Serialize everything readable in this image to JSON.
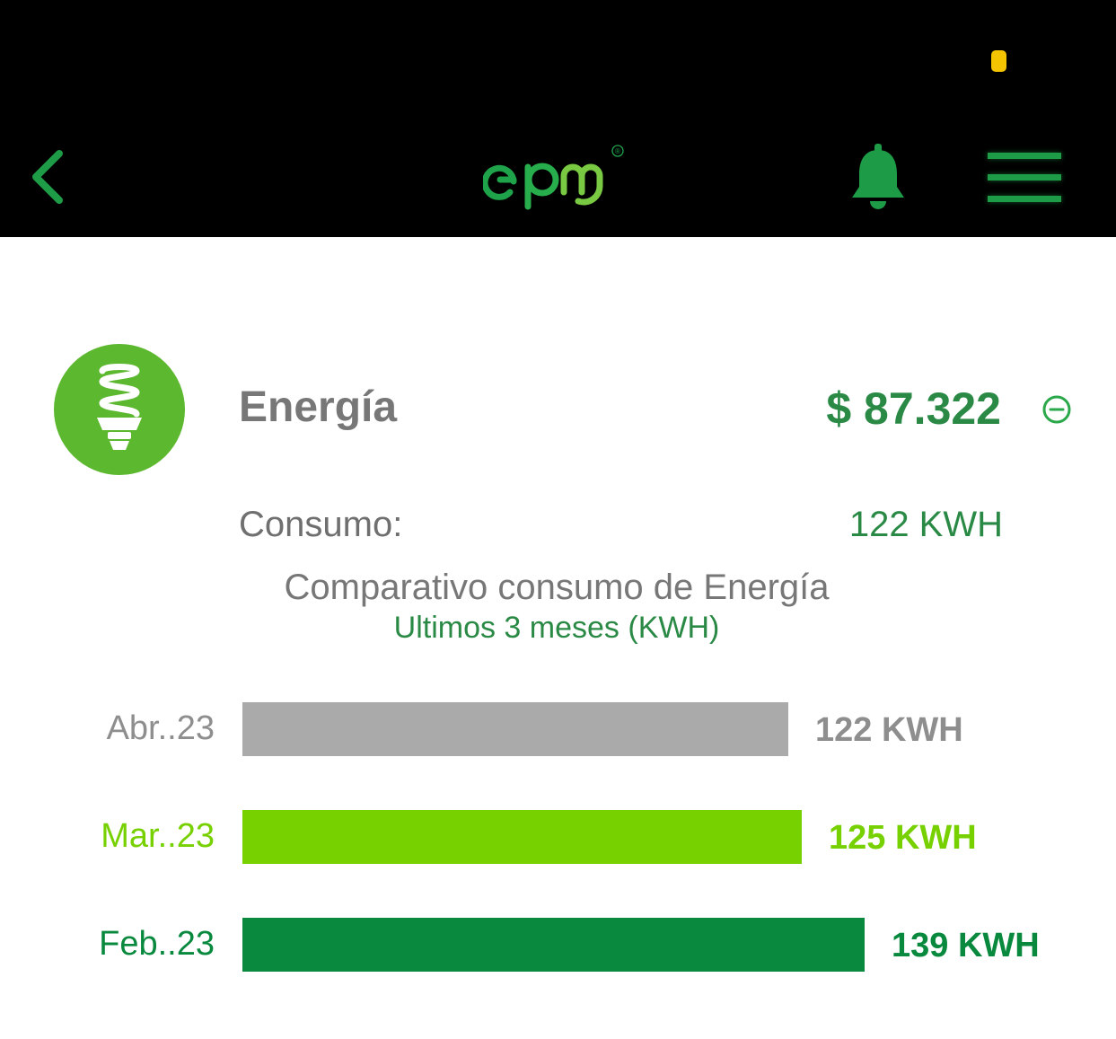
{
  "header": {
    "logo_text": "epm",
    "logo_mark": "®",
    "icons": [
      "chevron-left-icon",
      "bell-icon",
      "hamburger-menu-icon"
    ],
    "colors": {
      "bar_bg": "#000000",
      "accent": "#1e9b46",
      "status_dot": "#f5c400"
    }
  },
  "service": {
    "icon": "light-bulb-icon",
    "name": "Energía",
    "amount": "$ 87.322",
    "consumo_label": "Consumo:",
    "consumo_value": "122 KWH"
  },
  "comparison": {
    "title": "Comparativo consumo de Energía",
    "subtitle": "Ultimos 3 meses (KWH)"
  },
  "chart_data": {
    "type": "bar",
    "orientation": "horizontal",
    "categories": [
      "Abr..23",
      "Mar..23",
      "Feb..23"
    ],
    "values": [
      122,
      125,
      139
    ],
    "value_labels": [
      "122 KWH",
      "125 KWH",
      "139 KWH"
    ],
    "colors": [
      "#aaaaaa",
      "#77d000",
      "#08893e"
    ],
    "label_colors": [
      "#8e8e8e",
      "#77d000",
      "#08893e"
    ],
    "xlim": [
      0,
      139
    ],
    "grid": false
  }
}
